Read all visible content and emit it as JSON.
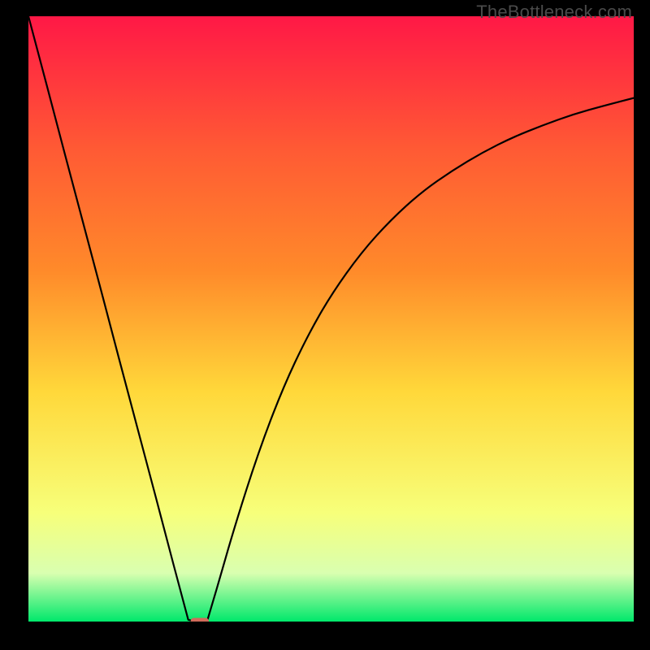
{
  "watermark": "TheBottleneck.com",
  "chart_data": {
    "type": "line",
    "title": "",
    "xlabel": "",
    "ylabel": "",
    "xlim": [
      0,
      1
    ],
    "ylim": [
      0,
      1
    ],
    "axes_visible": false,
    "grid": false,
    "background_gradient": {
      "top": "#ff1846",
      "upper_mid": "#ff8a2a",
      "mid": "#ffd83a",
      "lower_mid": "#f7ff7a",
      "lower": "#d9ffb0",
      "bottom": "#00e86b"
    },
    "series": [
      {
        "name": "left-branch",
        "x": [
          0.0,
          0.03,
          0.06,
          0.09,
          0.12,
          0.15,
          0.18,
          0.21,
          0.24,
          0.264,
          0.275
        ],
        "y": [
          1.0,
          0.887,
          0.773,
          0.66,
          0.547,
          0.433,
          0.32,
          0.207,
          0.093,
          0.003,
          0.0
        ]
      },
      {
        "name": "right-branch",
        "x": [
          0.295,
          0.31,
          0.34,
          0.38,
          0.42,
          0.46,
          0.5,
          0.55,
          0.6,
          0.65,
          0.7,
          0.75,
          0.8,
          0.85,
          0.9,
          0.95,
          1.0
        ],
        "y": [
          0.0,
          0.05,
          0.155,
          0.28,
          0.385,
          0.47,
          0.54,
          0.61,
          0.665,
          0.71,
          0.745,
          0.775,
          0.8,
          0.82,
          0.838,
          0.852,
          0.865
        ]
      }
    ],
    "marker": {
      "name": "min-marker",
      "x": 0.283,
      "y": 0.0,
      "color": "#d16a5a",
      "width_frac": 0.03,
      "height_frac": 0.012
    }
  }
}
